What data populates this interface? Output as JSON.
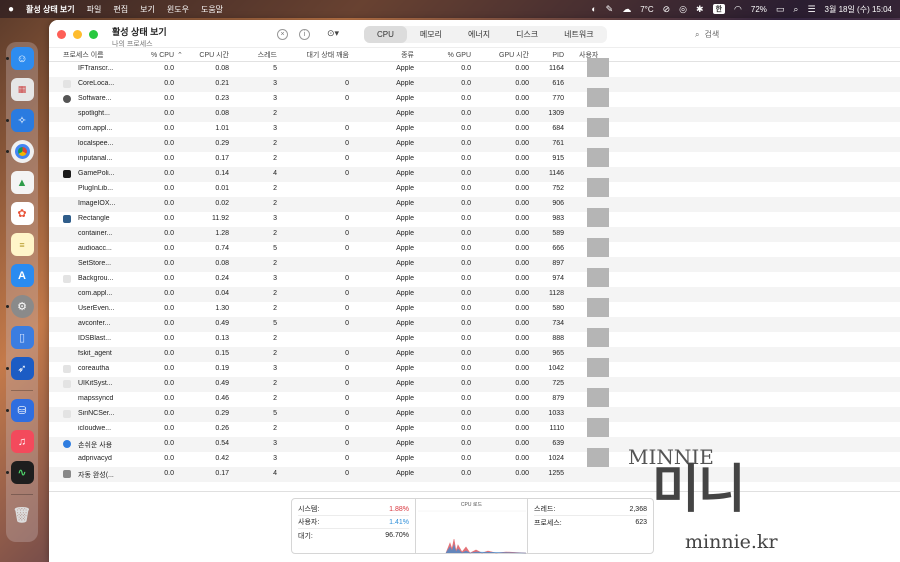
{
  "menubar": {
    "app_name": "활성 상태 보기",
    "items": [
      "파일",
      "편집",
      "보기",
      "윈도우",
      "도움말"
    ],
    "weather": "7°C",
    "kbd": "한",
    "battery": "72%",
    "datetime": "3월 18일 (수) 15:04"
  },
  "window": {
    "title": "활성 상태 보기",
    "subtitle": "나의 프로세스",
    "tabs": [
      "CPU",
      "메모리",
      "에너지",
      "디스크",
      "네트워크"
    ],
    "active_tab": "CPU",
    "search_placeholder": "검색"
  },
  "table": {
    "headers": {
      "name": "프로세스 이름",
      "cpu": "% CPU",
      "cpu_time": "CPU 시간",
      "threads": "스레드",
      "idle_wakeups": "대기 상태 깨움",
      "kind": "종류",
      "gpu": "% GPU",
      "gpu_time": "GPU 시간",
      "pid": "PID",
      "user": "사용자"
    },
    "rows": [
      {
        "name": "IFTranscr...",
        "cpu": "0.0",
        "cpu_time": "0.08",
        "threads": "5",
        "idle": "",
        "kind": "Apple",
        "gpu": "0.0",
        "gpu_time": "0.00",
        "pid": "1164",
        "icon": "none"
      },
      {
        "name": "CoreLoca...",
        "cpu": "0.0",
        "cpu_time": "0.21",
        "threads": "3",
        "idle": "0",
        "kind": "Apple",
        "gpu": "0.0",
        "gpu_time": "0.00",
        "pid": "616",
        "icon": "light"
      },
      {
        "name": "Software...",
        "cpu": "0.0",
        "cpu_time": "0.23",
        "threads": "3",
        "idle": "0",
        "kind": "Apple",
        "gpu": "0.0",
        "gpu_time": "0.00",
        "pid": "770",
        "icon": "gear"
      },
      {
        "name": "spotlight...",
        "cpu": "0.0",
        "cpu_time": "0.08",
        "threads": "2",
        "idle": "",
        "kind": "Apple",
        "gpu": "0.0",
        "gpu_time": "0.00",
        "pid": "1309",
        "icon": "none"
      },
      {
        "name": "com.appl...",
        "cpu": "0.0",
        "cpu_time": "1.01",
        "threads": "3",
        "idle": "0",
        "kind": "Apple",
        "gpu": "0.0",
        "gpu_time": "0.00",
        "pid": "684",
        "icon": "none"
      },
      {
        "name": "localspee...",
        "cpu": "0.0",
        "cpu_time": "0.29",
        "threads": "2",
        "idle": "0",
        "kind": "Apple",
        "gpu": "0.0",
        "gpu_time": "0.00",
        "pid": "761",
        "icon": "none"
      },
      {
        "name": "inputanal...",
        "cpu": "0.0",
        "cpu_time": "0.17",
        "threads": "2",
        "idle": "0",
        "kind": "Apple",
        "gpu": "0.0",
        "gpu_time": "0.00",
        "pid": "915",
        "icon": "none"
      },
      {
        "name": "GamePoli...",
        "cpu": "0.0",
        "cpu_time": "0.14",
        "threads": "4",
        "idle": "0",
        "kind": "Apple",
        "gpu": "0.0",
        "gpu_time": "0.00",
        "pid": "1146",
        "icon": "dark"
      },
      {
        "name": "PlugInLib...",
        "cpu": "0.0",
        "cpu_time": "0.01",
        "threads": "2",
        "idle": "",
        "kind": "Apple",
        "gpu": "0.0",
        "gpu_time": "0.00",
        "pid": "752",
        "icon": "none"
      },
      {
        "name": "ImageIOX...",
        "cpu": "0.0",
        "cpu_time": "0.02",
        "threads": "2",
        "idle": "",
        "kind": "Apple",
        "gpu": "0.0",
        "gpu_time": "0.00",
        "pid": "906",
        "icon": "none"
      },
      {
        "name": "Rectangle",
        "cpu": "0.0",
        "cpu_time": "11.92",
        "threads": "3",
        "idle": "0",
        "kind": "Apple",
        "gpu": "0.0",
        "gpu_time": "0.00",
        "pid": "983",
        "icon": "rect"
      },
      {
        "name": "container...",
        "cpu": "0.0",
        "cpu_time": "1.28",
        "threads": "2",
        "idle": "0",
        "kind": "Apple",
        "gpu": "0.0",
        "gpu_time": "0.00",
        "pid": "589",
        "icon": "none"
      },
      {
        "name": "audioacc...",
        "cpu": "0.0",
        "cpu_time": "0.74",
        "threads": "5",
        "idle": "0",
        "kind": "Apple",
        "gpu": "0.0",
        "gpu_time": "0.00",
        "pid": "666",
        "icon": "none"
      },
      {
        "name": "SetStore...",
        "cpu": "0.0",
        "cpu_time": "0.08",
        "threads": "2",
        "idle": "",
        "kind": "Apple",
        "gpu": "0.0",
        "gpu_time": "0.00",
        "pid": "897",
        "icon": "none"
      },
      {
        "name": "Backgrou...",
        "cpu": "0.0",
        "cpu_time": "0.24",
        "threads": "3",
        "idle": "0",
        "kind": "Apple",
        "gpu": "0.0",
        "gpu_time": "0.00",
        "pid": "974",
        "icon": "light"
      },
      {
        "name": "com.appl...",
        "cpu": "0.0",
        "cpu_time": "0.04",
        "threads": "2",
        "idle": "0",
        "kind": "Apple",
        "gpu": "0.0",
        "gpu_time": "0.00",
        "pid": "1128",
        "icon": "none"
      },
      {
        "name": "UserEven...",
        "cpu": "0.0",
        "cpu_time": "1.30",
        "threads": "2",
        "idle": "0",
        "kind": "Apple",
        "gpu": "0.0",
        "gpu_time": "0.00",
        "pid": "580",
        "icon": "none"
      },
      {
        "name": "avconfer...",
        "cpu": "0.0",
        "cpu_time": "0.49",
        "threads": "5",
        "idle": "0",
        "kind": "Apple",
        "gpu": "0.0",
        "gpu_time": "0.00",
        "pid": "734",
        "icon": "none"
      },
      {
        "name": "IDSBlast...",
        "cpu": "0.0",
        "cpu_time": "0.13",
        "threads": "2",
        "idle": "",
        "kind": "Apple",
        "gpu": "0.0",
        "gpu_time": "0.00",
        "pid": "888",
        "icon": "none"
      },
      {
        "name": "fskit_agent",
        "cpu": "0.0",
        "cpu_time": "0.15",
        "threads": "2",
        "idle": "0",
        "kind": "Apple",
        "gpu": "0.0",
        "gpu_time": "0.00",
        "pid": "965",
        "icon": "none"
      },
      {
        "name": "coreautha",
        "cpu": "0.0",
        "cpu_time": "0.19",
        "threads": "3",
        "idle": "0",
        "kind": "Apple",
        "gpu": "0.0",
        "gpu_time": "0.00",
        "pid": "1042",
        "icon": "light"
      },
      {
        "name": "UIKitSyst...",
        "cpu": "0.0",
        "cpu_time": "0.49",
        "threads": "2",
        "idle": "0",
        "kind": "Apple",
        "gpu": "0.0",
        "gpu_time": "0.00",
        "pid": "725",
        "icon": "light"
      },
      {
        "name": "mapssyncd",
        "cpu": "0.0",
        "cpu_time": "0.46",
        "threads": "2",
        "idle": "0",
        "kind": "Apple",
        "gpu": "0.0",
        "gpu_time": "0.00",
        "pid": "879",
        "icon": "none"
      },
      {
        "name": "SiriNCSer...",
        "cpu": "0.0",
        "cpu_time": "0.29",
        "threads": "5",
        "idle": "0",
        "kind": "Apple",
        "gpu": "0.0",
        "gpu_time": "0.00",
        "pid": "1033",
        "icon": "light"
      },
      {
        "name": "icloudwe...",
        "cpu": "0.0",
        "cpu_time": "0.26",
        "threads": "2",
        "idle": "0",
        "kind": "Apple",
        "gpu": "0.0",
        "gpu_time": "0.00",
        "pid": "1110",
        "icon": "none"
      },
      {
        "name": "손쉬운 사용",
        "cpu": "0.0",
        "cpu_time": "0.54",
        "threads": "3",
        "idle": "0",
        "kind": "Apple",
        "gpu": "0.0",
        "gpu_time": "0.00",
        "pid": "639",
        "icon": "blue"
      },
      {
        "name": "adprivacyd",
        "cpu": "0.0",
        "cpu_time": "0.42",
        "threads": "3",
        "idle": "0",
        "kind": "Apple",
        "gpu": "0.0",
        "gpu_time": "0.00",
        "pid": "1024",
        "icon": "none"
      },
      {
        "name": "자동 완성(...",
        "cpu": "0.0",
        "cpu_time": "0.17",
        "threads": "4",
        "idle": "0",
        "kind": "Apple",
        "gpu": "0.0",
        "gpu_time": "0.00",
        "pid": "1255",
        "icon": "gray"
      }
    ]
  },
  "footer": {
    "system_label": "시스템:",
    "system_value": "1.88%",
    "user_label": "사용자:",
    "user_value": "1.41%",
    "idle_label": "대기:",
    "idle_value": "96.70%",
    "chart_title": "CPU 로드",
    "threads_label": "스레드:",
    "threads_value": "2,368",
    "processes_label": "프로세스:",
    "processes_value": "623",
    "system_color": "#d9363e",
    "user_color": "#2f8fd9"
  },
  "watermark": {
    "top": "MINNIE",
    "mid": "미니",
    "bottom": "minnie.kr"
  }
}
